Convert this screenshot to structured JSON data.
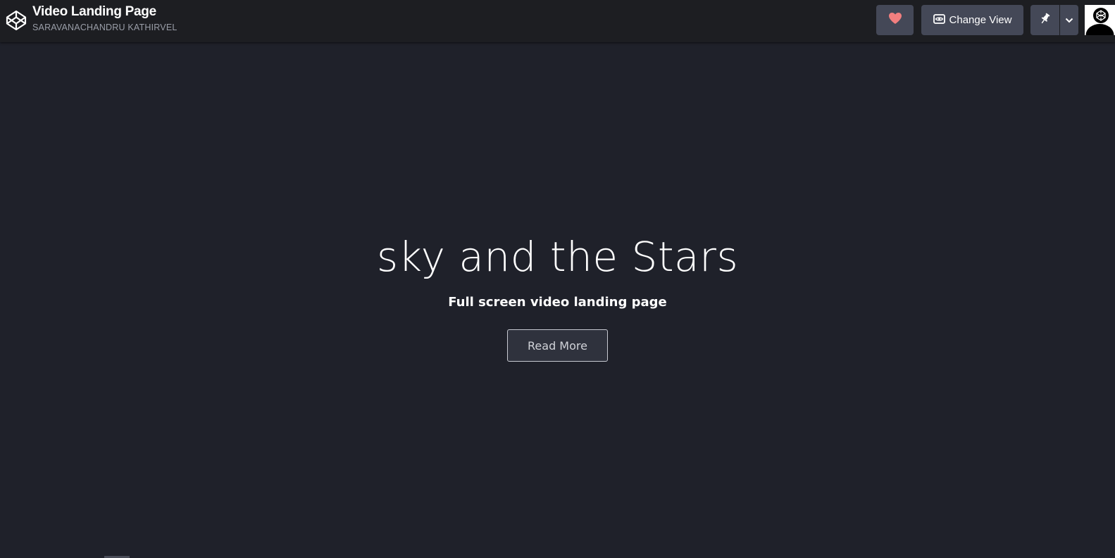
{
  "header": {
    "title": "Video Landing Page",
    "author": "SARAVANACHANDRU KATHIRVEL",
    "logo_icon": "codepen-logo-icon",
    "heart_icon": "heart-icon",
    "heart_color": "#f27f7f",
    "change_view_label": "Change View",
    "change_view_icon": "eye-icon",
    "pin_icon": "pin-icon",
    "menu_icon": "chevron-down-icon",
    "avatar_icon": "avatar"
  },
  "hero": {
    "title": "sky and the Stars",
    "subtitle": "Full screen video landing page",
    "button_label": "Read More"
  },
  "colors": {
    "background": "#1f212a",
    "topbar": "#1d1e22",
    "button": "#444857"
  }
}
